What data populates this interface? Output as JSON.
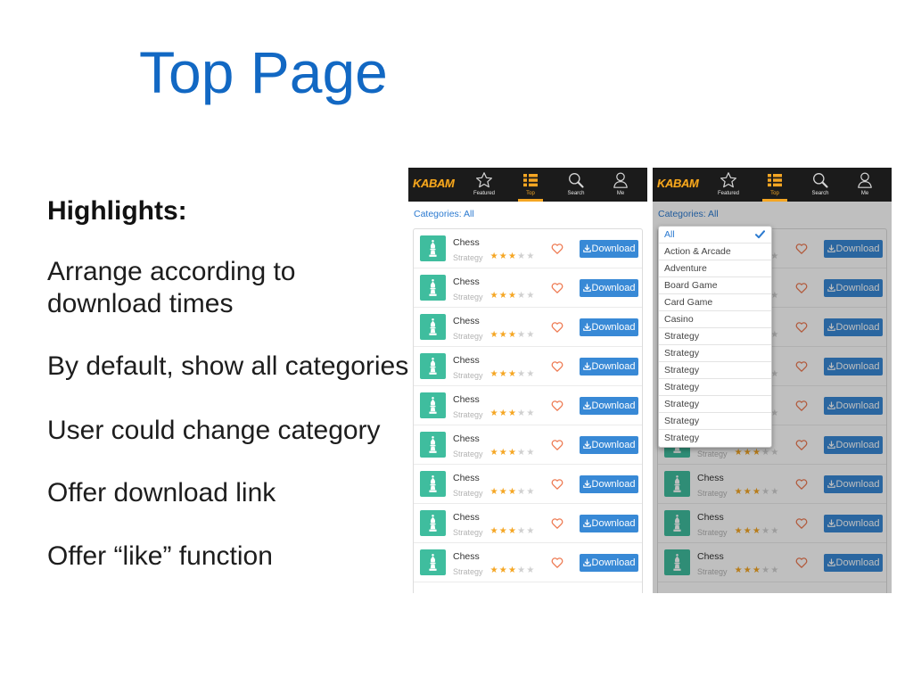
{
  "slide": {
    "title": "Top Page",
    "heading": "Highlights:",
    "points": [
      "Arrange according to download times",
      "By default, show all categories",
      "User could change category",
      "Offer download link",
      "Offer “like” function"
    ]
  },
  "app": {
    "logo_text": "KABAM",
    "tabs": [
      {
        "label": "Featured",
        "icon": "star-icon",
        "active": false
      },
      {
        "label": "Top",
        "icon": "list-icon",
        "active": true
      },
      {
        "label": "Search",
        "icon": "search-icon",
        "active": false
      },
      {
        "label": "Me",
        "icon": "user-icon",
        "active": false
      }
    ],
    "category_label": "Categories: All",
    "download_label": "Download",
    "games": [
      {
        "title": "Chess",
        "genre": "Strategy",
        "rating": 3,
        "max_rating": 5,
        "liked": false,
        "icon": "chess-piece-icon"
      },
      {
        "title": "Chess",
        "genre": "Strategy",
        "rating": 3,
        "max_rating": 5,
        "liked": false,
        "icon": "chess-piece-icon"
      },
      {
        "title": "Chess",
        "genre": "Strategy",
        "rating": 3,
        "max_rating": 5,
        "liked": false,
        "icon": "chess-piece-icon"
      },
      {
        "title": "Chess",
        "genre": "Strategy",
        "rating": 3,
        "max_rating": 5,
        "liked": false,
        "icon": "chess-piece-icon"
      },
      {
        "title": "Chess",
        "genre": "Strategy",
        "rating": 3,
        "max_rating": 5,
        "liked": false,
        "icon": "chess-piece-icon"
      },
      {
        "title": "Chess",
        "genre": "Strategy",
        "rating": 3,
        "max_rating": 5,
        "liked": false,
        "icon": "chess-piece-icon"
      },
      {
        "title": "Chess",
        "genre": "Strategy",
        "rating": 3,
        "max_rating": 5,
        "liked": false,
        "icon": "chess-piece-icon"
      },
      {
        "title": "Chess",
        "genre": "Strategy",
        "rating": 3,
        "max_rating": 5,
        "liked": false,
        "icon": "chess-piece-icon"
      },
      {
        "title": "Chess",
        "genre": "Strategy",
        "rating": 3,
        "max_rating": 5,
        "liked": false,
        "icon": "chess-piece-icon"
      }
    ]
  },
  "category_dropdown": {
    "selected": "All",
    "options": [
      "All",
      "Action & Arcade",
      "Adventure",
      "Board Game",
      "Card Game",
      "Casino",
      "Strategy",
      "Strategy",
      "Strategy",
      "Strategy",
      "Strategy",
      "Strategy",
      "Strategy"
    ]
  },
  "screens": [
    {
      "category_dropdown_open": false
    },
    {
      "category_dropdown_open": true
    }
  ],
  "colors": {
    "title": "#1268c3",
    "brand": "#f4a81f",
    "accent": "#f5a623",
    "link": "#2b7ad0",
    "download_button": "#3889d6",
    "game_icon": "#3fbd9e",
    "like_heart": "#ee7a52",
    "header": "#1b1b1b"
  }
}
